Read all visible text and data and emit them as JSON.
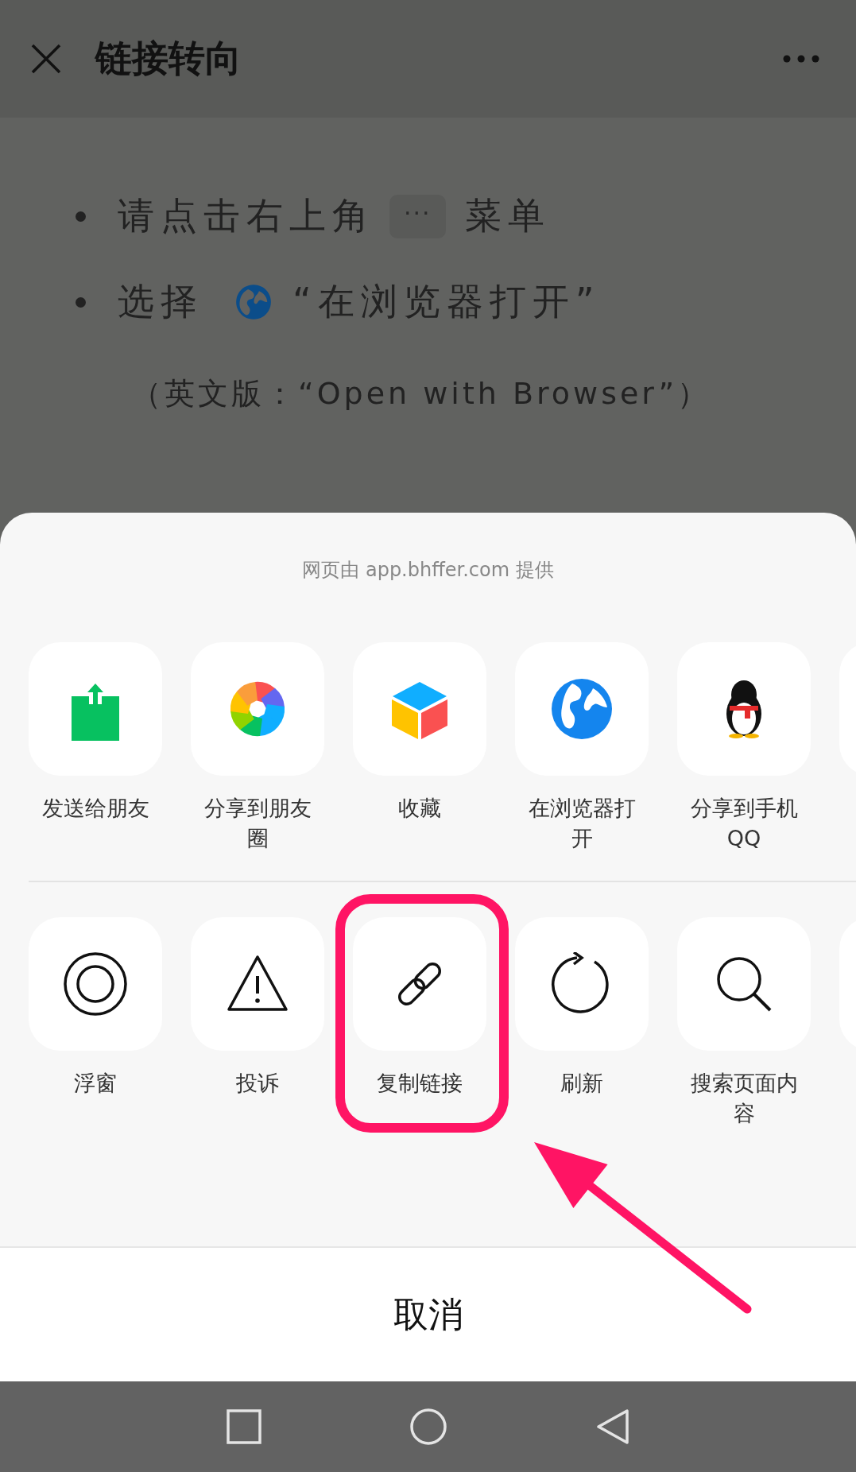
{
  "header": {
    "title": "链接转向"
  },
  "instructions": [
    {
      "segments": [
        {
          "kind": "text",
          "text": "请点击右上角"
        },
        {
          "kind": "menu-chip",
          "text": "···"
        },
        {
          "kind": "text",
          "text": "菜单"
        }
      ]
    },
    {
      "segments": [
        {
          "kind": "text",
          "text": "选择"
        },
        {
          "kind": "globe"
        },
        {
          "kind": "text",
          "text": "“在浏览器打开”"
        }
      ]
    }
  ],
  "note": "（英文版：“Open with Browser”）",
  "sheet": {
    "caption": "网页由 app.bhffer.com 提供",
    "rows": [
      {
        "actions": [
          {
            "label": "发送给朋友",
            "highlighted": false
          },
          {
            "label": "分享到朋友圈",
            "highlighted": false
          },
          {
            "label": "收藏",
            "highlighted": false
          },
          {
            "label": "在浏览器打开",
            "highlighted": false
          },
          {
            "label": "分享到手机QQ",
            "highlighted": false
          },
          {
            "highlighted": false
          }
        ]
      },
      {
        "actions": [
          {
            "label": "浮窗",
            "highlighted": false
          },
          {
            "label": "投诉",
            "highlighted": false
          },
          {
            "label": "复制链接",
            "highlighted": true
          },
          {
            "label": "刷新",
            "highlighted": false
          },
          {
            "label": "搜索页面内容",
            "highlighted": false
          },
          {
            "highlighted": false
          }
        ]
      }
    ]
  },
  "cancel": "取消"
}
